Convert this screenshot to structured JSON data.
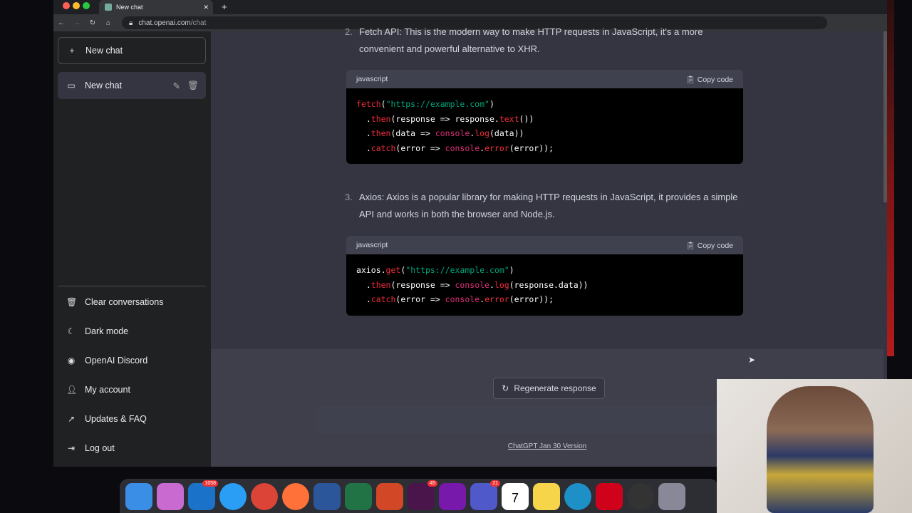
{
  "browser": {
    "tab_title": "New chat",
    "url_host": "chat.openai.com",
    "url_path": "/chat"
  },
  "sidebar": {
    "new_chat": "New chat",
    "chat_item": "New chat",
    "bottom_items": [
      {
        "label": "Clear conversations",
        "icon": "trash-icon"
      },
      {
        "label": "Dark mode",
        "icon": "moon-icon"
      },
      {
        "label": "OpenAI Discord",
        "icon": "discord-icon"
      },
      {
        "label": "My account",
        "icon": "user-icon"
      },
      {
        "label": "Updates & FAQ",
        "icon": "external-link-icon"
      },
      {
        "label": "Log out",
        "icon": "logout-icon"
      }
    ]
  },
  "main": {
    "item2_num": "2.",
    "item2_text": "Fetch API: This is the modern way to make HTTP requests in JavaScript, it's a more convenient and powerful alternative to XHR.",
    "code1": {
      "lang": "javascript",
      "copy": "Copy code"
    },
    "item3_num": "3.",
    "item3_text": "Axios: Axios is a popular library for making HTTP requests in JavaScript, it provides a simple API and works in both the browser and Node.js.",
    "code2": {
      "lang": "javascript",
      "copy": "Copy code"
    },
    "regenerate": "Regenerate response",
    "footer": "ChatGPT Jan 30 Version"
  },
  "dock": {
    "badges": [
      "1058",
      "45",
      "21"
    ],
    "calendar": "7"
  },
  "colors": {
    "sidebar": "#202123",
    "main": "#343541",
    "code_bg": "#000000",
    "keyword": "#f22c3d",
    "string": "#00a67d"
  }
}
